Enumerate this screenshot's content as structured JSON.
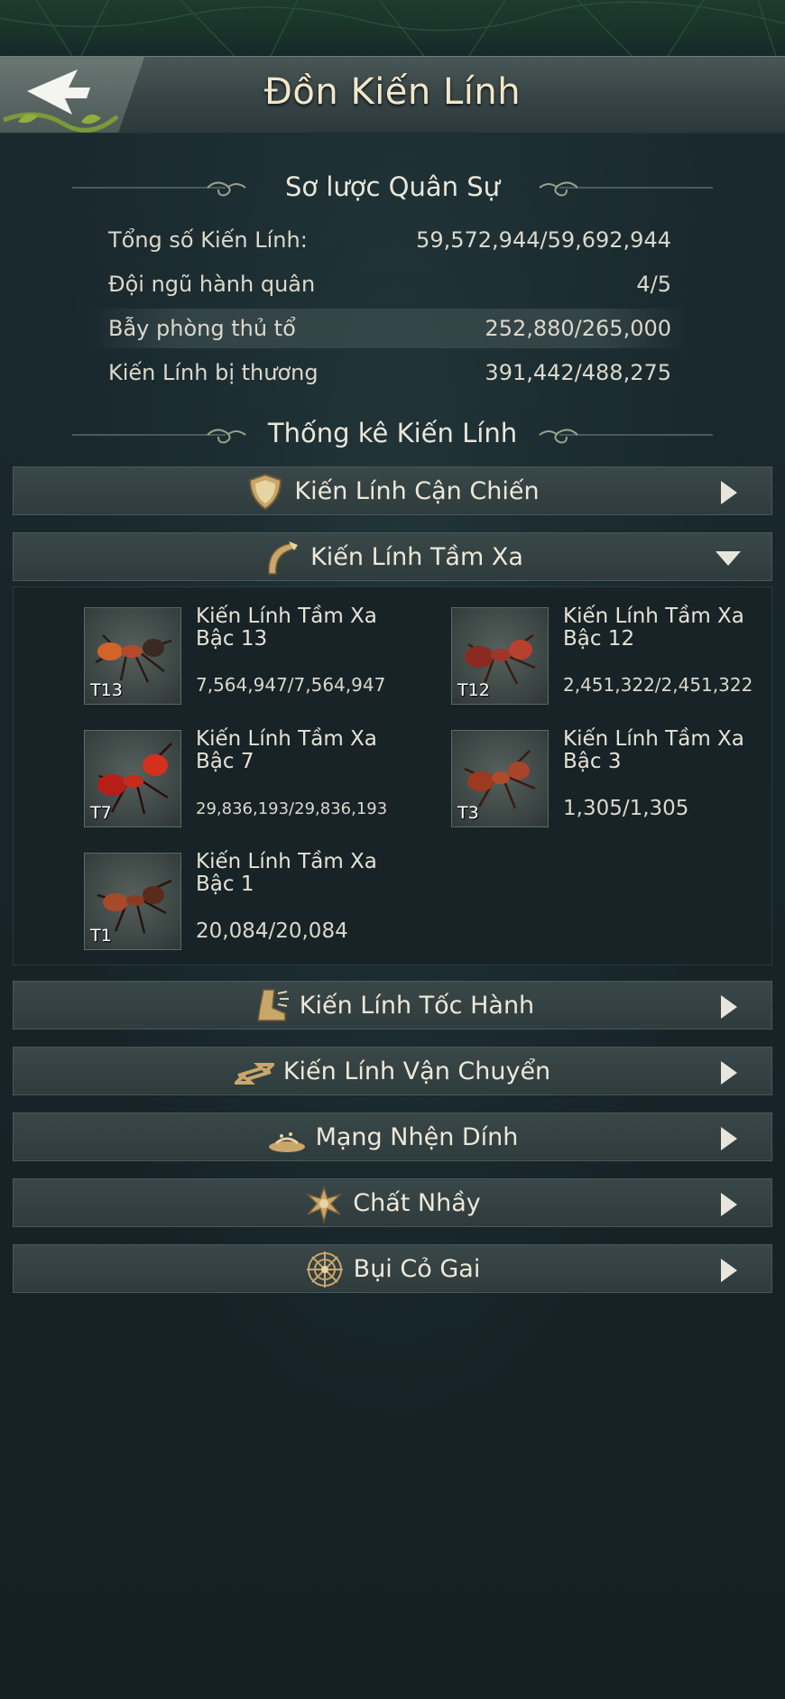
{
  "header": {
    "title": "Đồn Kiến Lính"
  },
  "overview": {
    "title": "Sơ lược Quân Sự",
    "rows": [
      {
        "label": "Tổng số Kiến Lính:",
        "value": "59,572,944/59,692,944"
      },
      {
        "label": "Đội ngũ hành quân",
        "value": "4/5"
      },
      {
        "label": "Bẫy phòng thủ tổ",
        "value": "252,880/265,000"
      },
      {
        "label": "Kiến Lính bị thương",
        "value": "391,442/488,275"
      }
    ]
  },
  "stats": {
    "title": "Thống kê Kiến Lính"
  },
  "categories": [
    {
      "label": "Kiến Lính Cận Chiến",
      "icon": "shield-icon"
    },
    {
      "label": "Kiến Lính Tầm Xa",
      "icon": "bow-icon"
    },
    {
      "label": "Kiến Lính Tốc Hành",
      "icon": "boot-icon"
    },
    {
      "label": "Kiến Lính Vận Chuyển",
      "icon": "transport-icon"
    },
    {
      "label": "Mạng Nhện Dính",
      "icon": "web-trap-icon"
    },
    {
      "label": "Chất Nhầy",
      "icon": "slime-icon"
    },
    {
      "label": "Bụi Cỏ Gai",
      "icon": "thorn-bush-icon"
    }
  ],
  "ranged_units": [
    {
      "tier": "T13",
      "name_line1": "Kiến Lính Tầm Xa",
      "name_line2": "Bậc 13",
      "count": "7,564,947/7,564,947"
    },
    {
      "tier": "T12",
      "name_line1": "Kiến Lính Tầm Xa",
      "name_line2": "Bậc 12",
      "count": "2,451,322/2,451,322"
    },
    {
      "tier": "T7",
      "name_line1": "Kiến Lính Tầm Xa",
      "name_line2": "Bậc 7",
      "count": "29,836,193/29,836,193"
    },
    {
      "tier": "T3",
      "name_line1": "Kiến Lính Tầm Xa",
      "name_line2": "Bậc 3",
      "count": "1,305/1,305"
    },
    {
      "tier": "T1",
      "name_line1": "Kiến Lính Tầm Xa",
      "name_line2": "Bậc 1",
      "count": "20,084/20,084"
    }
  ],
  "colors": {
    "accent_gold": "#c9a76a",
    "title_cream": "#f2e7c9"
  }
}
